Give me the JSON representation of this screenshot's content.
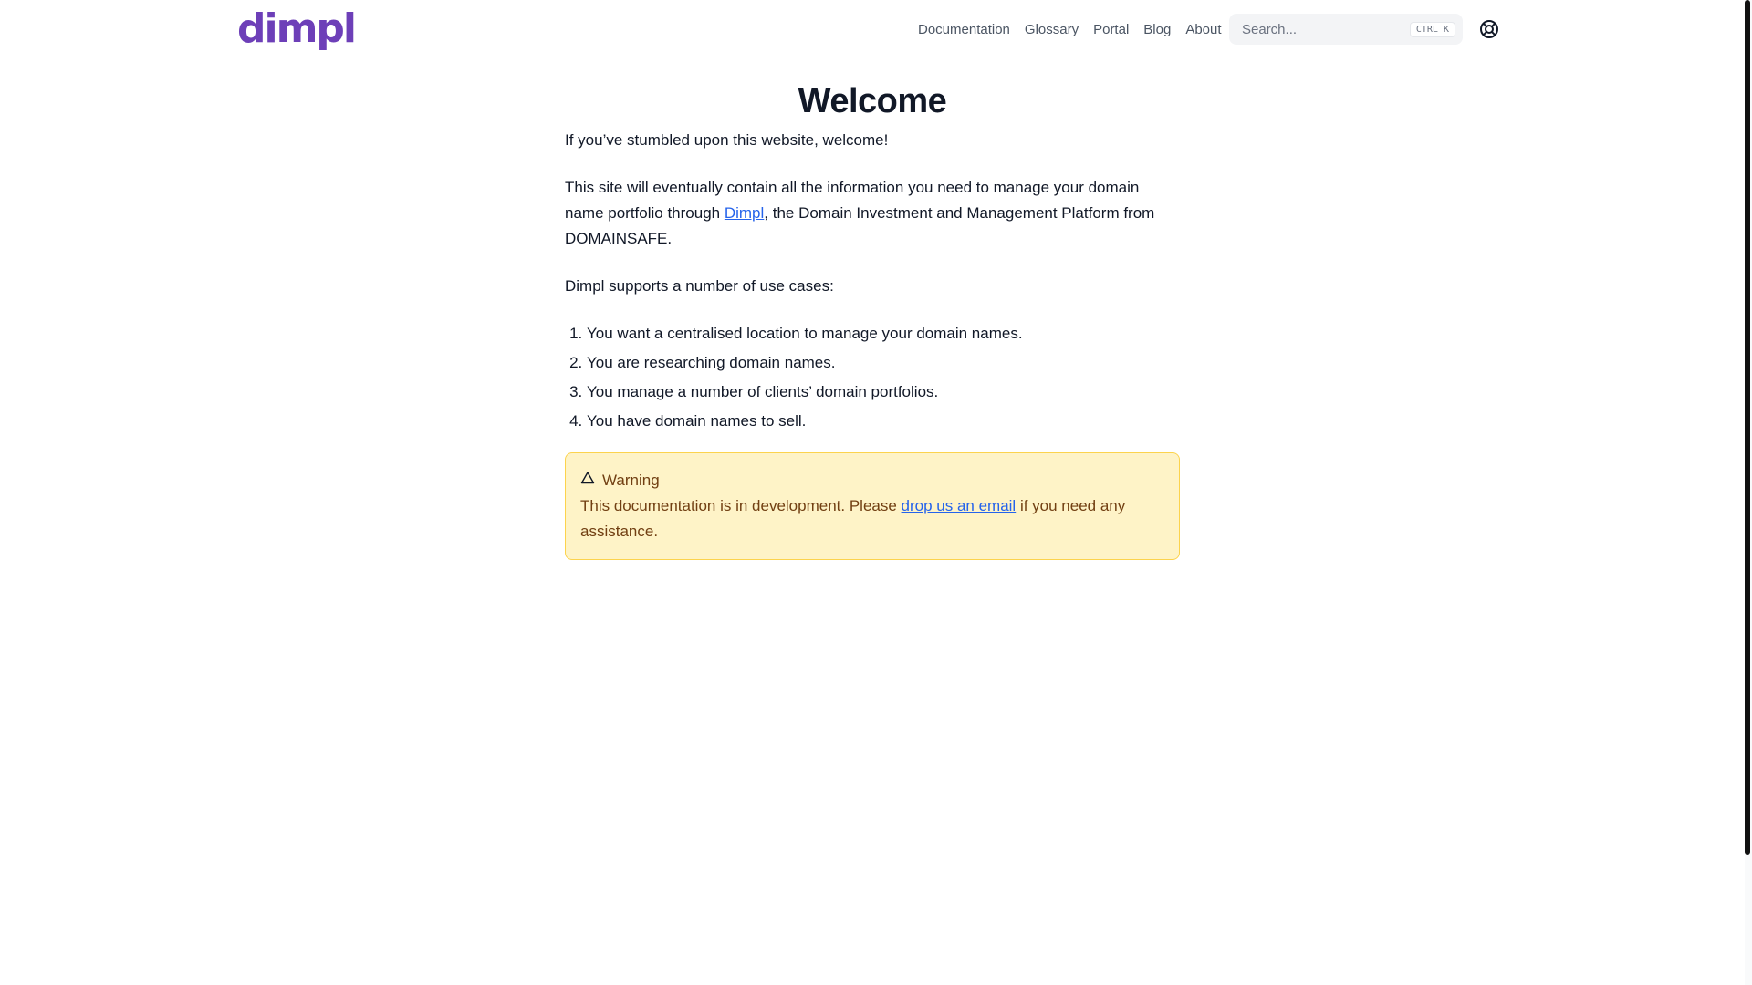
{
  "header": {
    "logo_text": "dimpl",
    "nav": [
      {
        "label": "Documentation"
      },
      {
        "label": "Glossary"
      },
      {
        "label": "Portal"
      },
      {
        "label": "Blog"
      },
      {
        "label": "About"
      }
    ],
    "search": {
      "placeholder": "Search...",
      "shortcut": "CTRL K",
      "icon": "search-icon"
    },
    "theme_toggle_icon": "lifebuoy-icon"
  },
  "main": {
    "title": "Welcome",
    "intro": "If you’ve stumbled upon this website, welcome!",
    "para2": {
      "before": "This site will eventually contain all the information you need to manage your domain name portfolio through ",
      "link": "Dimpl",
      "after": ", the Domain Investment and Management Platform from DOMAINSAFE."
    },
    "para3": "Dimpl supports a number of use cases:",
    "use_cases": [
      "You want a centralised location to manage your domain names.",
      "You are researching domain names.",
      "You manage a number of clients’ domain portfolios.",
      "You have domain names to sell."
    ],
    "callout": {
      "icon": "warning-triangle-icon",
      "title": "Warning",
      "before": "This documentation is in development. Please ",
      "link": "drop us an email",
      "after": " if you need any assistance."
    }
  },
  "colors": {
    "brand": "#6d3fb8",
    "link": "#2563eb",
    "callout_bg": "#fef3c7",
    "callout_border": "#fcd34d",
    "callout_text": "#713f12"
  }
}
